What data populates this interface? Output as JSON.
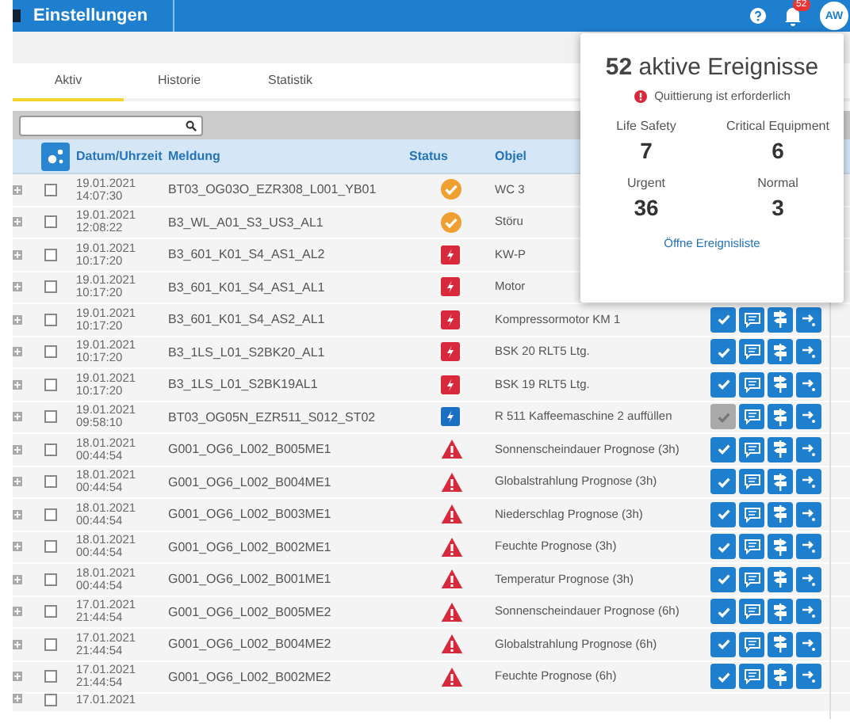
{
  "topbar": {
    "title": "Einstellungen",
    "notification_count": "52",
    "avatar": "AW"
  },
  "tabs": [
    {
      "label": "Aktiv",
      "selected": true
    },
    {
      "label": "Historie",
      "selected": false
    },
    {
      "label": "Statistik",
      "selected": false
    }
  ],
  "table": {
    "columns": [
      "Datum/Uhrzeit",
      "Meldung",
      "Status",
      "Objel"
    ],
    "rows": [
      {
        "date": "19.01.2021",
        "time": "14:07:30",
        "message": "BT03_OG03O_EZR308_L001_YB01",
        "kind": "done",
        "object": "WC 3",
        "checked": false
      },
      {
        "date": "19.01.2021",
        "time": "12:08:22",
        "message": "B3_WL_A01_S3_US3_AL1",
        "kind": "done",
        "object": "Störu",
        "checked": false
      },
      {
        "date": "19.01.2021",
        "time": "10:17:20",
        "message": "B3_601_K01_S4_AS1_AL2",
        "kind": "alarm",
        "object": "KW-P",
        "checked": false
      },
      {
        "date": "19.01.2021",
        "time": "10:17:20",
        "message": "B3_601_K01_S4_AS1_AL1",
        "kind": "alarm",
        "object": "Motor",
        "checked": false
      },
      {
        "date": "19.01.2021",
        "time": "10:17:20",
        "message": "B3_601_K01_S4_AS2_AL1",
        "kind": "alarm",
        "object": "Kompressormotor KM 1",
        "checked": false,
        "ack_enabled": true
      },
      {
        "date": "19.01.2021",
        "time": "10:17:20",
        "message": "B3_1LS_L01_S2BK20_AL1",
        "kind": "alarm",
        "object": "BSK 20 RLT5 Ltg.",
        "checked": false,
        "ack_enabled": true
      },
      {
        "date": "19.01.2021",
        "time": "10:17:20",
        "message": "B3_1LS_L01_S2BK19AL1",
        "kind": "alarm",
        "object": "BSK 19 RLT5 Ltg.",
        "checked": false,
        "ack_enabled": true
      },
      {
        "date": "19.01.2021",
        "time": "09:58:10",
        "message": "BT03_OG05N_EZR511_S012_ST02",
        "kind": "info",
        "object": "R 511 Kaffeemaschine 2 auffüllen",
        "checked": false,
        "ack_enabled": false
      },
      {
        "date": "18.01.2021",
        "time": "00:44:54",
        "message": "G001_OG6_L002_B005ME1",
        "kind": "warning",
        "object": "Sonnenscheindauer Prognose (3h)",
        "checked": false,
        "ack_enabled": true
      },
      {
        "date": "18.01.2021",
        "time": "00:44:54",
        "message": "G001_OG6_L002_B004ME1",
        "kind": "warning",
        "object": "Globalstrahlung Prognose (3h)",
        "checked": false,
        "ack_enabled": true
      },
      {
        "date": "18.01.2021",
        "time": "00:44:54",
        "message": "G001_OG6_L002_B003ME1",
        "kind": "warning",
        "object": "Niederschlag Prognose (3h)",
        "checked": false,
        "ack_enabled": true
      },
      {
        "date": "18.01.2021",
        "time": "00:44:54",
        "message": "G001_OG6_L002_B002ME1",
        "kind": "warning",
        "object": "Feuchte Prognose (3h)",
        "checked": false,
        "ack_enabled": true
      },
      {
        "date": "18.01.2021",
        "time": "00:44:54",
        "message": "G001_OG6_L002_B001ME1",
        "kind": "warning",
        "object": "Temperatur Prognose (3h)",
        "checked": false,
        "ack_enabled": true
      },
      {
        "date": "17.01.2021",
        "time": "21:44:54",
        "message": "G001_OG6_L002_B005ME2",
        "kind": "warning",
        "object": "Sonnenscheindauer Prognose (6h)",
        "checked": false,
        "ack_enabled": true
      },
      {
        "date": "17.01.2021",
        "time": "21:44:54",
        "message": "G001_OG6_L002_B004ME2",
        "kind": "warning",
        "object": "Globalstrahlung Prognose (6h)",
        "checked": false,
        "ack_enabled": true
      },
      {
        "date": "17.01.2021",
        "time": "21:44:54",
        "message": "G001_OG6_L002_B002ME2",
        "kind": "warning",
        "object": "Feuchte Prognose (6h)",
        "checked": false,
        "ack_enabled": true
      },
      {
        "date": "17.01.2021",
        "checked": false
      }
    ]
  },
  "popup": {
    "title": "**52** aktive Ereignisse",
    "alert": "Quittierung ist erforderlich",
    "categories": [
      {
        "label": "Life Safety",
        "count": "7"
      },
      {
        "label": "Critical Equipment",
        "count": "6"
      },
      {
        "label": "Urgent",
        "count": "36"
      },
      {
        "label": "Normal",
        "count": "3"
      }
    ],
    "link": "Öffne Ereignisliste"
  }
}
